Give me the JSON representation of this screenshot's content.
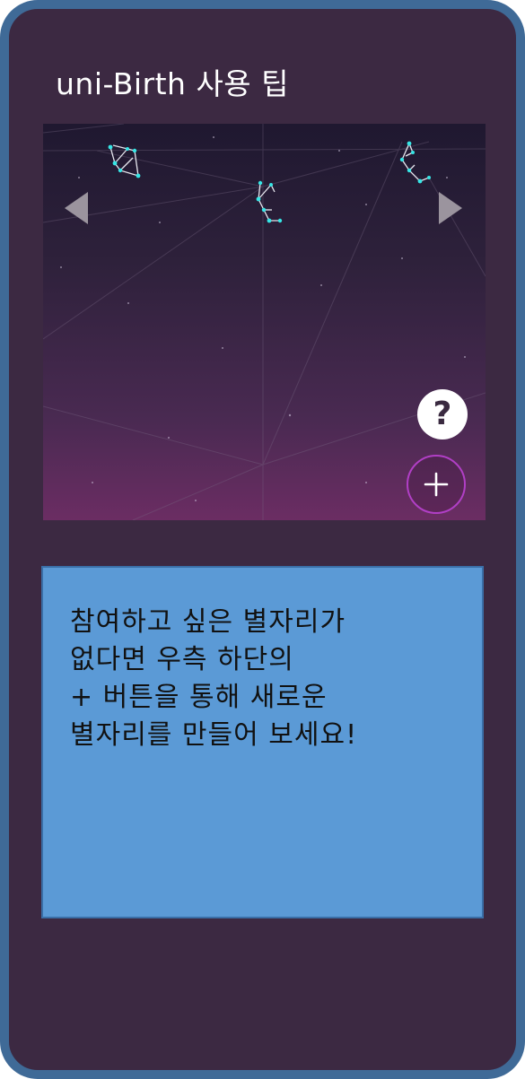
{
  "title": "uni-Birth 사용 팁",
  "preview": {
    "prev_icon": "triangle-left",
    "next_icon": "triangle-right",
    "help_label": "?",
    "add_icon": "plus",
    "constellation_color": "#36e6e6",
    "add_border_color": "#b13fc6"
  },
  "tip": {
    "lines": [
      "참여하고 싶은 별자리가",
      "없다면 우측 하단의",
      "+ 버튼을 통해 새로운",
      "별자리를 만들어 보세요!"
    ],
    "background_color": "#5b9ad6"
  },
  "colors": {
    "frame_border": "#3f6a97",
    "frame_background": "#3c2942"
  }
}
